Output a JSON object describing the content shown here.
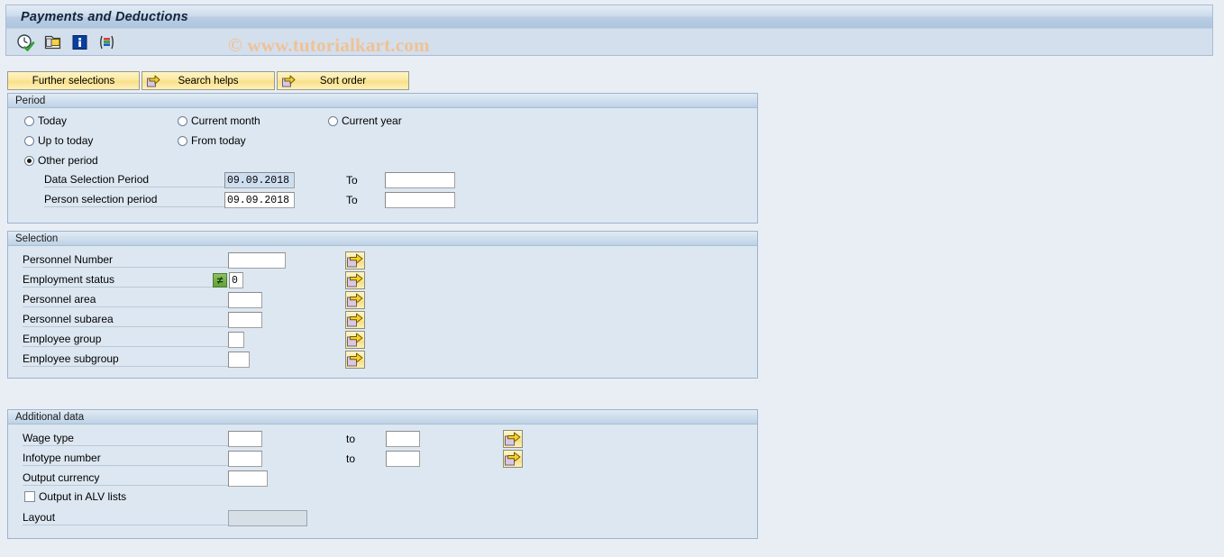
{
  "window": {
    "title": "Payments and Deductions"
  },
  "watermark": {
    "text": "© www.tutorialkart.com"
  },
  "toolbar": {
    "icons": [
      {
        "name": "execute-clock-check-icon",
        "title": "Execute"
      },
      {
        "name": "get-variant-icon",
        "title": "Get Variant"
      },
      {
        "name": "info-icon",
        "title": "Information"
      },
      {
        "name": "color-bars-icon",
        "title": "Layout"
      }
    ]
  },
  "action_buttons": {
    "further_selections": "Further selections",
    "search_helps": "Search helps",
    "sort_order": "Sort order"
  },
  "period": {
    "group_title": "Period",
    "options": [
      {
        "label": "Today",
        "selected": false
      },
      {
        "label": "Current month",
        "selected": false
      },
      {
        "label": "Current year",
        "selected": false
      },
      {
        "label": "Up to today",
        "selected": false
      },
      {
        "label": "From today",
        "selected": false
      },
      {
        "label": "Other period",
        "selected": true
      }
    ],
    "fields": [
      {
        "label": "Data Selection Period",
        "value": "09.09.2018",
        "focused": true,
        "to_label": "To",
        "to_value": ""
      },
      {
        "label": "Person selection period",
        "value": "09.09.2018",
        "focused": false,
        "to_label": "To",
        "to_value": ""
      }
    ]
  },
  "selection": {
    "group_title": "Selection",
    "rows": [
      {
        "label": "Personnel Number",
        "value": "",
        "operator": null,
        "has_multi": true
      },
      {
        "label": "Employment status",
        "value": "0",
        "operator": "≠",
        "has_multi": true
      },
      {
        "label": "Personnel area",
        "value": "",
        "operator": null,
        "has_multi": true
      },
      {
        "label": "Personnel subarea",
        "value": "",
        "operator": null,
        "has_multi": true
      },
      {
        "label": "Employee group",
        "value": "",
        "operator": null,
        "has_multi": true
      },
      {
        "label": "Employee subgroup",
        "value": "",
        "operator": null,
        "has_multi": true
      }
    ]
  },
  "additional_data": {
    "group_title": "Additional data",
    "rows": [
      {
        "label": "Wage type",
        "value": "",
        "to_label": "to",
        "to_value": "",
        "has_multi": true
      },
      {
        "label": "Infotype number",
        "value": "",
        "to_label": "to",
        "to_value": "",
        "has_multi": true
      },
      {
        "label": "Output currency",
        "value": "",
        "to_label": "",
        "to_value": "",
        "has_multi": false
      }
    ],
    "checkbox": {
      "label": "Output in ALV lists",
      "checked": false
    },
    "layout": {
      "label": "Layout",
      "value": "",
      "disabled": true
    }
  },
  "colors": {
    "page_background": "#e9eef5",
    "group_background": "#dde7f1",
    "title_bar": "#bdd1e5",
    "button_yellow": "#fae893",
    "operator_green": "#63a03a",
    "watermark": "#f0c196",
    "selected_field": "#cddef0"
  }
}
